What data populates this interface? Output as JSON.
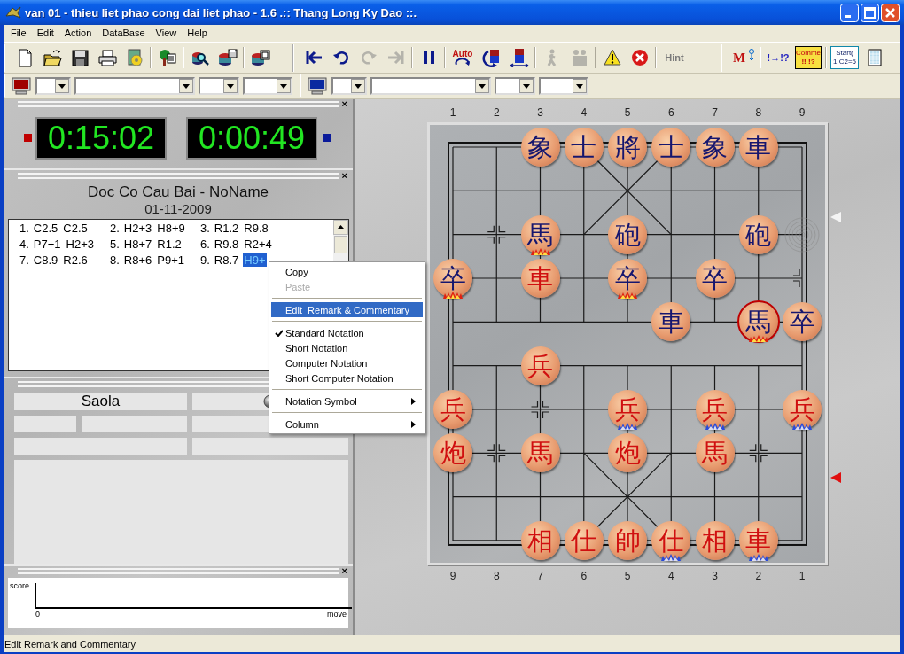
{
  "window": {
    "title": "van 01 - thieu liet phao cong dai liet phao - 1.6 .:: Thang Long Ky Dao ::."
  },
  "menu": [
    "File",
    "Edit",
    "Action",
    "DataBase",
    "View",
    "Help"
  ],
  "toolbars": [
    {
      "items": [
        {
          "kind": "new",
          "disabled": false
        },
        {
          "kind": "open",
          "disabled": false
        },
        {
          "kind": "save",
          "disabled": false
        },
        {
          "kind": "print",
          "disabled": false
        },
        {
          "kind": "gear",
          "disabled": false
        },
        {
          "kind": "separator"
        },
        {
          "kind": "tree",
          "disabled": false
        },
        {
          "kind": "separator"
        },
        {
          "kind": "search",
          "disabled": false
        },
        {
          "kind": "database",
          "disabled": false
        },
        {
          "kind": "separator"
        },
        {
          "kind": "database-pages",
          "disabled": false
        }
      ]
    },
    {
      "items": [
        {
          "kind": "first",
          "disabled": false
        },
        {
          "kind": "undo",
          "disabled": false
        },
        {
          "kind": "redo",
          "disabled": true
        },
        {
          "kind": "last",
          "disabled": true
        },
        {
          "kind": "separator"
        },
        {
          "kind": "pause",
          "disabled": false
        },
        {
          "kind": "separator"
        },
        {
          "kind": "auto",
          "label": "Auto",
          "disabled": false
        },
        {
          "kind": "rotate",
          "disabled": false
        },
        {
          "kind": "flip",
          "disabled": false
        },
        {
          "kind": "separator"
        },
        {
          "kind": "walk",
          "disabled": true
        },
        {
          "kind": "people",
          "disabled": true
        },
        {
          "kind": "separator"
        },
        {
          "kind": "warning",
          "disabled": false
        },
        {
          "kind": "stop",
          "disabled": false
        },
        {
          "kind": "separator"
        },
        {
          "kind": "hint",
          "label": "Hint",
          "disabled": true
        }
      ]
    },
    {
      "items": [
        {
          "kind": "engine-move",
          "label": "M",
          "disabled": false
        },
        {
          "kind": "separator"
        },
        {
          "kind": "annotate",
          "label": "!→!?",
          "disabled": false
        },
        {
          "kind": "comment",
          "lines": [
            "Comme",
            "!! !?"
          ],
          "disabled": false
        },
        {
          "kind": "separator"
        },
        {
          "kind": "start",
          "lines": [
            "Start(",
            "1.C2=5"
          ],
          "disabled": false
        },
        {
          "kind": "grid",
          "disabled": false
        }
      ]
    }
  ],
  "engine_selectors": [
    {
      "color": "#a00000"
    },
    {
      "color": "#0a2aa0"
    }
  ],
  "clock_panel": {
    "close": "×",
    "clocks": [
      {
        "color": "#c00000",
        "time": "0:15:02"
      },
      {
        "color": "#0a1a9a",
        "time": "0:00:49"
      }
    ]
  },
  "game_panel": {
    "close": "×",
    "title": "Doc Co Cau Bai - NoName",
    "date": "01-11-2009",
    "moves": [
      {
        "number": "1.",
        "plies": [
          {
            "text": "C2.5",
            "selected": false
          },
          {
            "text": "C2.5",
            "selected": false
          }
        ]
      },
      {
        "number": "2.",
        "plies": [
          {
            "text": "H2+3",
            "selected": false
          },
          {
            "text": "H8+9",
            "selected": false
          }
        ]
      },
      {
        "number": "3.",
        "plies": [
          {
            "text": "R1.2",
            "selected": false
          },
          {
            "text": "R9.8",
            "selected": false
          }
        ]
      },
      {
        "number": "4.",
        "plies": [
          {
            "text": "P7+1",
            "selected": false
          },
          {
            "text": "H2+3",
            "selected": false
          }
        ]
      },
      {
        "number": "5.",
        "plies": [
          {
            "text": "H8+7",
            "selected": false
          },
          {
            "text": "R1.2",
            "selected": false
          }
        ]
      },
      {
        "number": "6.",
        "plies": [
          {
            "text": "R9.8",
            "selected": false
          },
          {
            "text": "R2+4",
            "selected": false
          }
        ]
      },
      {
        "number": "7.",
        "plies": [
          {
            "text": "C8.9",
            "selected": false
          },
          {
            "text": "R2.6",
            "selected": false
          }
        ]
      },
      {
        "number": "8.",
        "plies": [
          {
            "text": "R8+6",
            "selected": false
          },
          {
            "text": "P9+1",
            "selected": false
          }
        ]
      },
      {
        "number": "9.",
        "plies": [
          {
            "text": "R8.7",
            "selected": false
          },
          {
            "text": "H9+",
            "selected": true
          }
        ]
      }
    ]
  },
  "engine_panel": {
    "engine": "Saola"
  },
  "score_panel": {
    "close": "×",
    "ylabel": "score",
    "origin": "0",
    "xlabel": "move"
  },
  "board": {
    "top_files": [
      "1",
      "2",
      "3",
      "4",
      "5",
      "6",
      "7",
      "8",
      "9"
    ],
    "bottom_files": [
      "9",
      "8",
      "7",
      "6",
      "5",
      "4",
      "3",
      "2",
      "1"
    ],
    "ranks": [
      [
        {
          "kind": "empty"
        },
        {
          "kind": "empty"
        },
        {
          "kind": "piece",
          "char": "象",
          "color": "#16166e",
          "selected": false,
          "attacked": false
        },
        {
          "kind": "piece",
          "char": "士",
          "color": "#16166e",
          "selected": false,
          "attacked": false
        },
        {
          "kind": "piece",
          "char": "將",
          "color": "#16166e",
          "selected": false,
          "attacked": false
        },
        {
          "kind": "piece",
          "char": "士",
          "color": "#16166e",
          "selected": false,
          "attacked": false
        },
        {
          "kind": "piece",
          "char": "象",
          "color": "#16166e",
          "selected": false,
          "attacked": false
        },
        {
          "kind": "piece",
          "char": "車",
          "color": "#16166e",
          "selected": false,
          "attacked": false
        },
        {
          "kind": "empty"
        }
      ],
      [
        {
          "kind": "empty"
        },
        {
          "kind": "empty"
        },
        {
          "kind": "empty"
        },
        {
          "kind": "empty"
        },
        {
          "kind": "empty"
        },
        {
          "kind": "empty"
        },
        {
          "kind": "empty"
        },
        {
          "kind": "empty"
        },
        {
          "kind": "empty"
        }
      ],
      [
        {
          "kind": "empty"
        },
        {
          "kind": "empty"
        },
        {
          "kind": "piece",
          "char": "馬",
          "color": "#16166e",
          "selected": false,
          "attacked": true
        },
        {
          "kind": "empty"
        },
        {
          "kind": "piece",
          "char": "砲",
          "color": "#16166e",
          "selected": false,
          "attacked": false
        },
        {
          "kind": "empty"
        },
        {
          "kind": "empty"
        },
        {
          "kind": "piece",
          "char": "砲",
          "color": "#16166e",
          "selected": false,
          "attacked": false
        },
        {
          "kind": "empty"
        }
      ],
      [
        {
          "kind": "piece",
          "char": "卒",
          "color": "#16166e",
          "selected": false,
          "attacked": true
        },
        {
          "kind": "empty"
        },
        {
          "kind": "piece",
          "char": "車",
          "color": "#d01010",
          "selected": false,
          "attacked": false
        },
        {
          "kind": "empty"
        },
        {
          "kind": "piece",
          "char": "卒",
          "color": "#16166e",
          "selected": false,
          "attacked": true
        },
        {
          "kind": "empty"
        },
        {
          "kind": "piece",
          "char": "卒",
          "color": "#16166e",
          "selected": false,
          "attacked": false
        },
        {
          "kind": "empty"
        },
        {
          "kind": "empty"
        }
      ],
      [
        {
          "kind": "empty"
        },
        {
          "kind": "empty"
        },
        {
          "kind": "empty"
        },
        {
          "kind": "empty"
        },
        {
          "kind": "empty"
        },
        {
          "kind": "piece",
          "char": "車",
          "color": "#16166e",
          "selected": false,
          "attacked": false
        },
        {
          "kind": "empty"
        },
        {
          "kind": "piece",
          "char": "馬",
          "color": "#16166e",
          "selected": true,
          "attacked": true
        },
        {
          "kind": "piece",
          "char": "卒",
          "color": "#16166e",
          "selected": false,
          "attacked": false
        }
      ],
      [
        {
          "kind": "empty"
        },
        {
          "kind": "empty"
        },
        {
          "kind": "piece",
          "char": "兵",
          "color": "#d01010",
          "selected": false,
          "attacked": false
        },
        {
          "kind": "empty"
        },
        {
          "kind": "empty"
        },
        {
          "kind": "empty"
        },
        {
          "kind": "empty"
        },
        {
          "kind": "empty"
        },
        {
          "kind": "empty"
        }
      ],
      [
        {
          "kind": "piece",
          "char": "兵",
          "color": "#d01010",
          "selected": false,
          "attacked": false
        },
        {
          "kind": "empty"
        },
        {
          "kind": "empty"
        },
        {
          "kind": "empty"
        },
        {
          "kind": "piece",
          "char": "兵",
          "color": "#d01010",
          "selected": false,
          "attacked": true
        },
        {
          "kind": "empty"
        },
        {
          "kind": "piece",
          "char": "兵",
          "color": "#d01010",
          "selected": false,
          "attacked": true
        },
        {
          "kind": "empty"
        },
        {
          "kind": "piece",
          "char": "兵",
          "color": "#d01010",
          "selected": false,
          "attacked": true
        }
      ],
      [
        {
          "kind": "piece",
          "char": "炮",
          "color": "#d01010",
          "selected": false,
          "attacked": false
        },
        {
          "kind": "empty"
        },
        {
          "kind": "piece",
          "char": "馬",
          "color": "#d01010",
          "selected": false,
          "attacked": false
        },
        {
          "kind": "empty"
        },
        {
          "kind": "piece",
          "char": "炮",
          "color": "#d01010",
          "selected": false,
          "attacked": false
        },
        {
          "kind": "empty"
        },
        {
          "kind": "piece",
          "char": "馬",
          "color": "#d01010",
          "selected": false,
          "attacked": false
        },
        {
          "kind": "empty"
        },
        {
          "kind": "empty"
        }
      ],
      [
        {
          "kind": "empty"
        },
        {
          "kind": "empty"
        },
        {
          "kind": "empty"
        },
        {
          "kind": "empty"
        },
        {
          "kind": "empty"
        },
        {
          "kind": "empty"
        },
        {
          "kind": "empty"
        },
        {
          "kind": "empty"
        },
        {
          "kind": "empty"
        }
      ],
      [
        {
          "kind": "empty"
        },
        {
          "kind": "empty"
        },
        {
          "kind": "piece",
          "char": "相",
          "color": "#d01010",
          "selected": false,
          "attacked": false
        },
        {
          "kind": "piece",
          "char": "仕",
          "color": "#d01010",
          "selected": false,
          "attacked": false
        },
        {
          "kind": "piece",
          "char": "帥",
          "color": "#d01010",
          "selected": false,
          "attacked": false
        },
        {
          "kind": "piece",
          "char": "仕",
          "color": "#d01010",
          "selected": false,
          "attacked": true
        },
        {
          "kind": "piece",
          "char": "相",
          "color": "#d01010",
          "selected": false,
          "attacked": false
        },
        {
          "kind": "piece",
          "char": "車",
          "color": "#d01010",
          "selected": false,
          "attacked": true
        },
        {
          "kind": "empty"
        }
      ]
    ]
  },
  "context_menu": {
    "items": [
      {
        "kind": "item",
        "label": "Copy",
        "disabled": false,
        "selected": false,
        "checked": false,
        "submenu": false
      },
      {
        "kind": "item",
        "label": "Paste",
        "disabled": true,
        "selected": false,
        "checked": false,
        "submenu": false
      },
      {
        "kind": "separator"
      },
      {
        "kind": "item",
        "label": "Edit  Remark & Commentary",
        "disabled": false,
        "selected": true,
        "checked": false,
        "submenu": false
      },
      {
        "kind": "separator"
      },
      {
        "kind": "item",
        "label": "Standard Notation",
        "disabled": false,
        "selected": false,
        "checked": true,
        "submenu": false
      },
      {
        "kind": "item",
        "label": "Short Notation",
        "disabled": false,
        "selected": false,
        "checked": false,
        "submenu": false
      },
      {
        "kind": "item",
        "label": "Computer Notation",
        "disabled": false,
        "selected": false,
        "checked": false,
        "submenu": false
      },
      {
        "kind": "item",
        "label": "Short Computer Notation",
        "disabled": false,
        "selected": false,
        "checked": false,
        "submenu": false
      },
      {
        "kind": "separator"
      },
      {
        "kind": "item",
        "label": "Notation Symbol",
        "disabled": false,
        "selected": false,
        "checked": false,
        "submenu": true
      },
      {
        "kind": "separator"
      },
      {
        "kind": "item",
        "label": "Column",
        "disabled": false,
        "selected": false,
        "checked": false,
        "submenu": true
      }
    ]
  },
  "status_bar": {
    "text": "Edit Remark and Commentary"
  }
}
